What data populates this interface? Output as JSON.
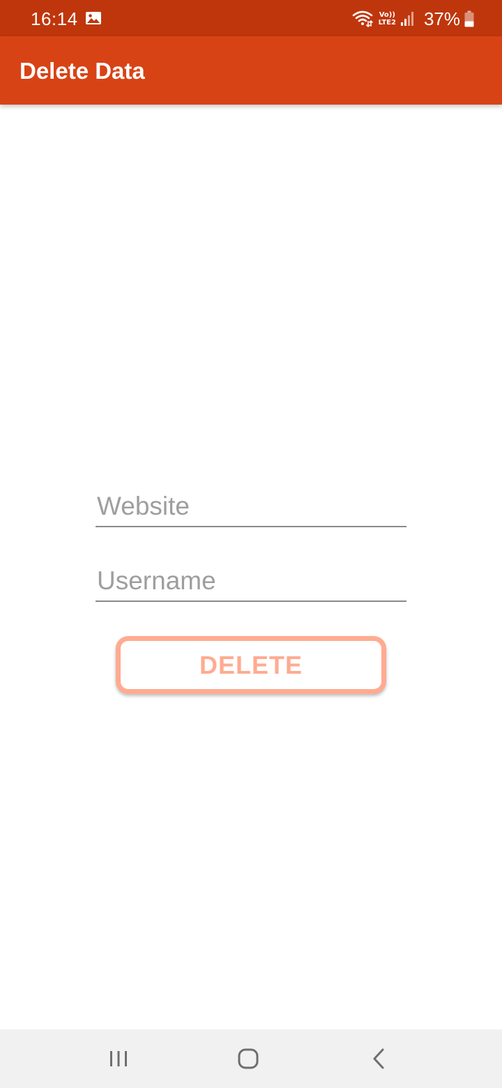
{
  "status_bar": {
    "time": "16:14",
    "volte_top": "Vo))",
    "volte_bottom": "LTE2",
    "battery_percent": "37%",
    "icons": [
      "gallery-icon",
      "wifi-icon",
      "signal-icon",
      "battery-icon"
    ]
  },
  "app_bar": {
    "title": "Delete Data"
  },
  "form": {
    "website_placeholder": "Website",
    "website_value": "",
    "username_placeholder": "Username",
    "username_value": "",
    "delete_label": "DELETE"
  },
  "nav_bar": {
    "icons": [
      "recents-icon",
      "home-icon",
      "back-icon"
    ]
  },
  "colors": {
    "status_bar": "#bf360c",
    "app_bar": "#d84315",
    "button_accent": "#ffab91",
    "placeholder": "#9e9e9e",
    "underline": "#8a8a8a",
    "nav_bar": "#f1f1f1"
  }
}
